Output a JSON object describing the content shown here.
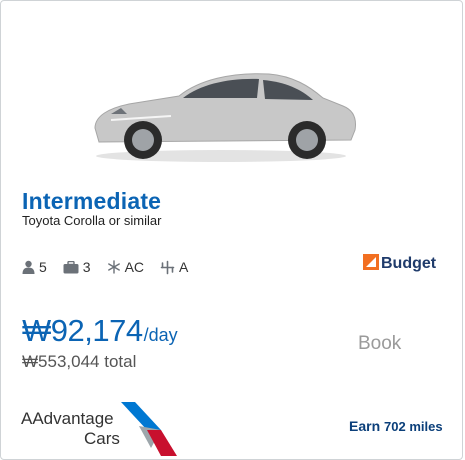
{
  "offer": {
    "category": "Intermediate",
    "vehicle": "Toyota Corolla or similar",
    "features": {
      "passengers": "5",
      "bags": "3",
      "ac": "AC",
      "transmission": "A"
    },
    "vendor": "Budget",
    "price": {
      "amount": "₩92,174",
      "unit": "/day",
      "total": "₩553,044 total"
    },
    "book_label": "Book",
    "brand": {
      "line1": "AAdvantage",
      "line2": "Cars"
    },
    "earn": {
      "prefix": "Earn",
      "miles": "702 miles"
    }
  },
  "icons": {
    "passengers": "person-icon",
    "bags": "suitcase-icon",
    "ac": "snowflake-icon",
    "transmission": "gearshift-icon"
  },
  "colors": {
    "accent": "#0b64b4",
    "budget_orange": "#f26f21",
    "aa_red": "#c8102e",
    "aa_blue": "#0078d2"
  }
}
